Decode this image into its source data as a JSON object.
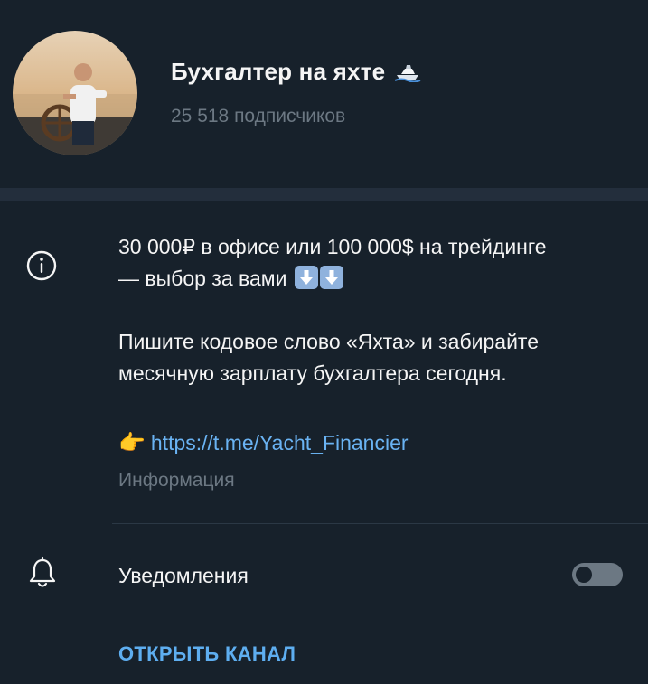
{
  "channel": {
    "name": "Бухгалтер на яхте",
    "subscribers": "25 518 подписчиков"
  },
  "about": {
    "line1": "30 000₽ в офисе или 100 000$ на трейдинге",
    "line2": "— выбор за вами",
    "line3": "Пишите кодовое слово «Яхта» и забирайте",
    "line4": "месячную зарплату бухгалтера сегодня.",
    "link_emoji": "👉",
    "link": "https://t.me/Yacht_Financier",
    "label": "Информация"
  },
  "notifications": {
    "label": "Уведомления",
    "enabled": false
  },
  "actions": {
    "open_channel": "ОТКРЫТЬ КАНАЛ"
  },
  "icons": {
    "info": "info-icon",
    "bell": "bell-icon",
    "yacht": "yacht-icon",
    "arrow": "down-arrow-emoji"
  },
  "colors": {
    "background": "#17212b",
    "band": "#232e3c",
    "muted": "#6c7883",
    "link": "#6ab3f3",
    "accent": "#5eaef0"
  }
}
